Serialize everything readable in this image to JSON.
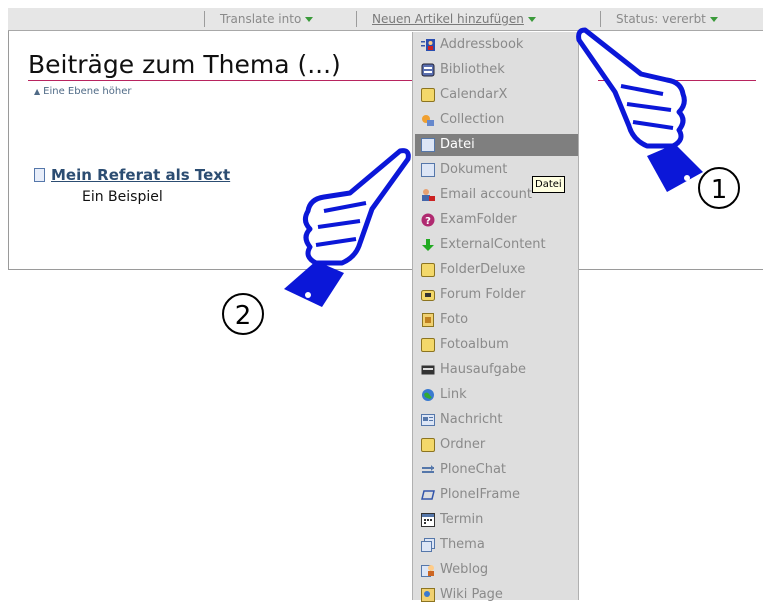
{
  "toolbar": {
    "translate": "Translate into",
    "add_item": "Neuen Artikel hinzufügen",
    "status": "Status: vererbt"
  },
  "content": {
    "title": "Beiträge zum Thema (...)",
    "up_link": "Eine Ebene höher",
    "item_title": "Mein Referat als Text",
    "item_desc": "Ein Beispiel"
  },
  "menu": {
    "items": [
      {
        "label": "Addressbook",
        "icon": "addressbook-icon"
      },
      {
        "label": "Bibliothek",
        "icon": "library-icon"
      },
      {
        "label": "CalendarX",
        "icon": "folder-icon"
      },
      {
        "label": "Collection",
        "icon": "collection-icon"
      },
      {
        "label": "Datei",
        "icon": "file-icon",
        "highlighted": true
      },
      {
        "label": "Dokument",
        "icon": "document-icon"
      },
      {
        "label": "Email account",
        "icon": "email-account-icon"
      },
      {
        "label": "ExamFolder",
        "icon": "help-icon"
      },
      {
        "label": "ExternalContent",
        "icon": "download-arrow-icon"
      },
      {
        "label": "FolderDeluxe",
        "icon": "folder-icon"
      },
      {
        "label": "Forum Folder",
        "icon": "forum-folder-icon"
      },
      {
        "label": "Foto",
        "icon": "image-icon"
      },
      {
        "label": "Fotoalbum",
        "icon": "folder-icon"
      },
      {
        "label": "Hausaufgabe",
        "icon": "homework-icon"
      },
      {
        "label": "Link",
        "icon": "globe-link-icon"
      },
      {
        "label": "Nachricht",
        "icon": "news-icon"
      },
      {
        "label": "Ordner",
        "icon": "folder-icon"
      },
      {
        "label": "PloneChat",
        "icon": "chat-icon"
      },
      {
        "label": "PloneIFrame",
        "icon": "iframe-icon"
      },
      {
        "label": "Termin",
        "icon": "calendar-icon"
      },
      {
        "label": "Thema",
        "icon": "topic-icon"
      },
      {
        "label": "Weblog",
        "icon": "weblog-icon"
      },
      {
        "label": "Wiki Page",
        "icon": "wiki-icon"
      }
    ]
  },
  "tooltip": "Datei",
  "callouts": [
    "1",
    "2"
  ],
  "colors": {
    "hand_blue": "#0b17d8",
    "title_rule": "#b8245f",
    "menu_bg": "#dedede",
    "menu_highlight": "#7f7f7f"
  }
}
